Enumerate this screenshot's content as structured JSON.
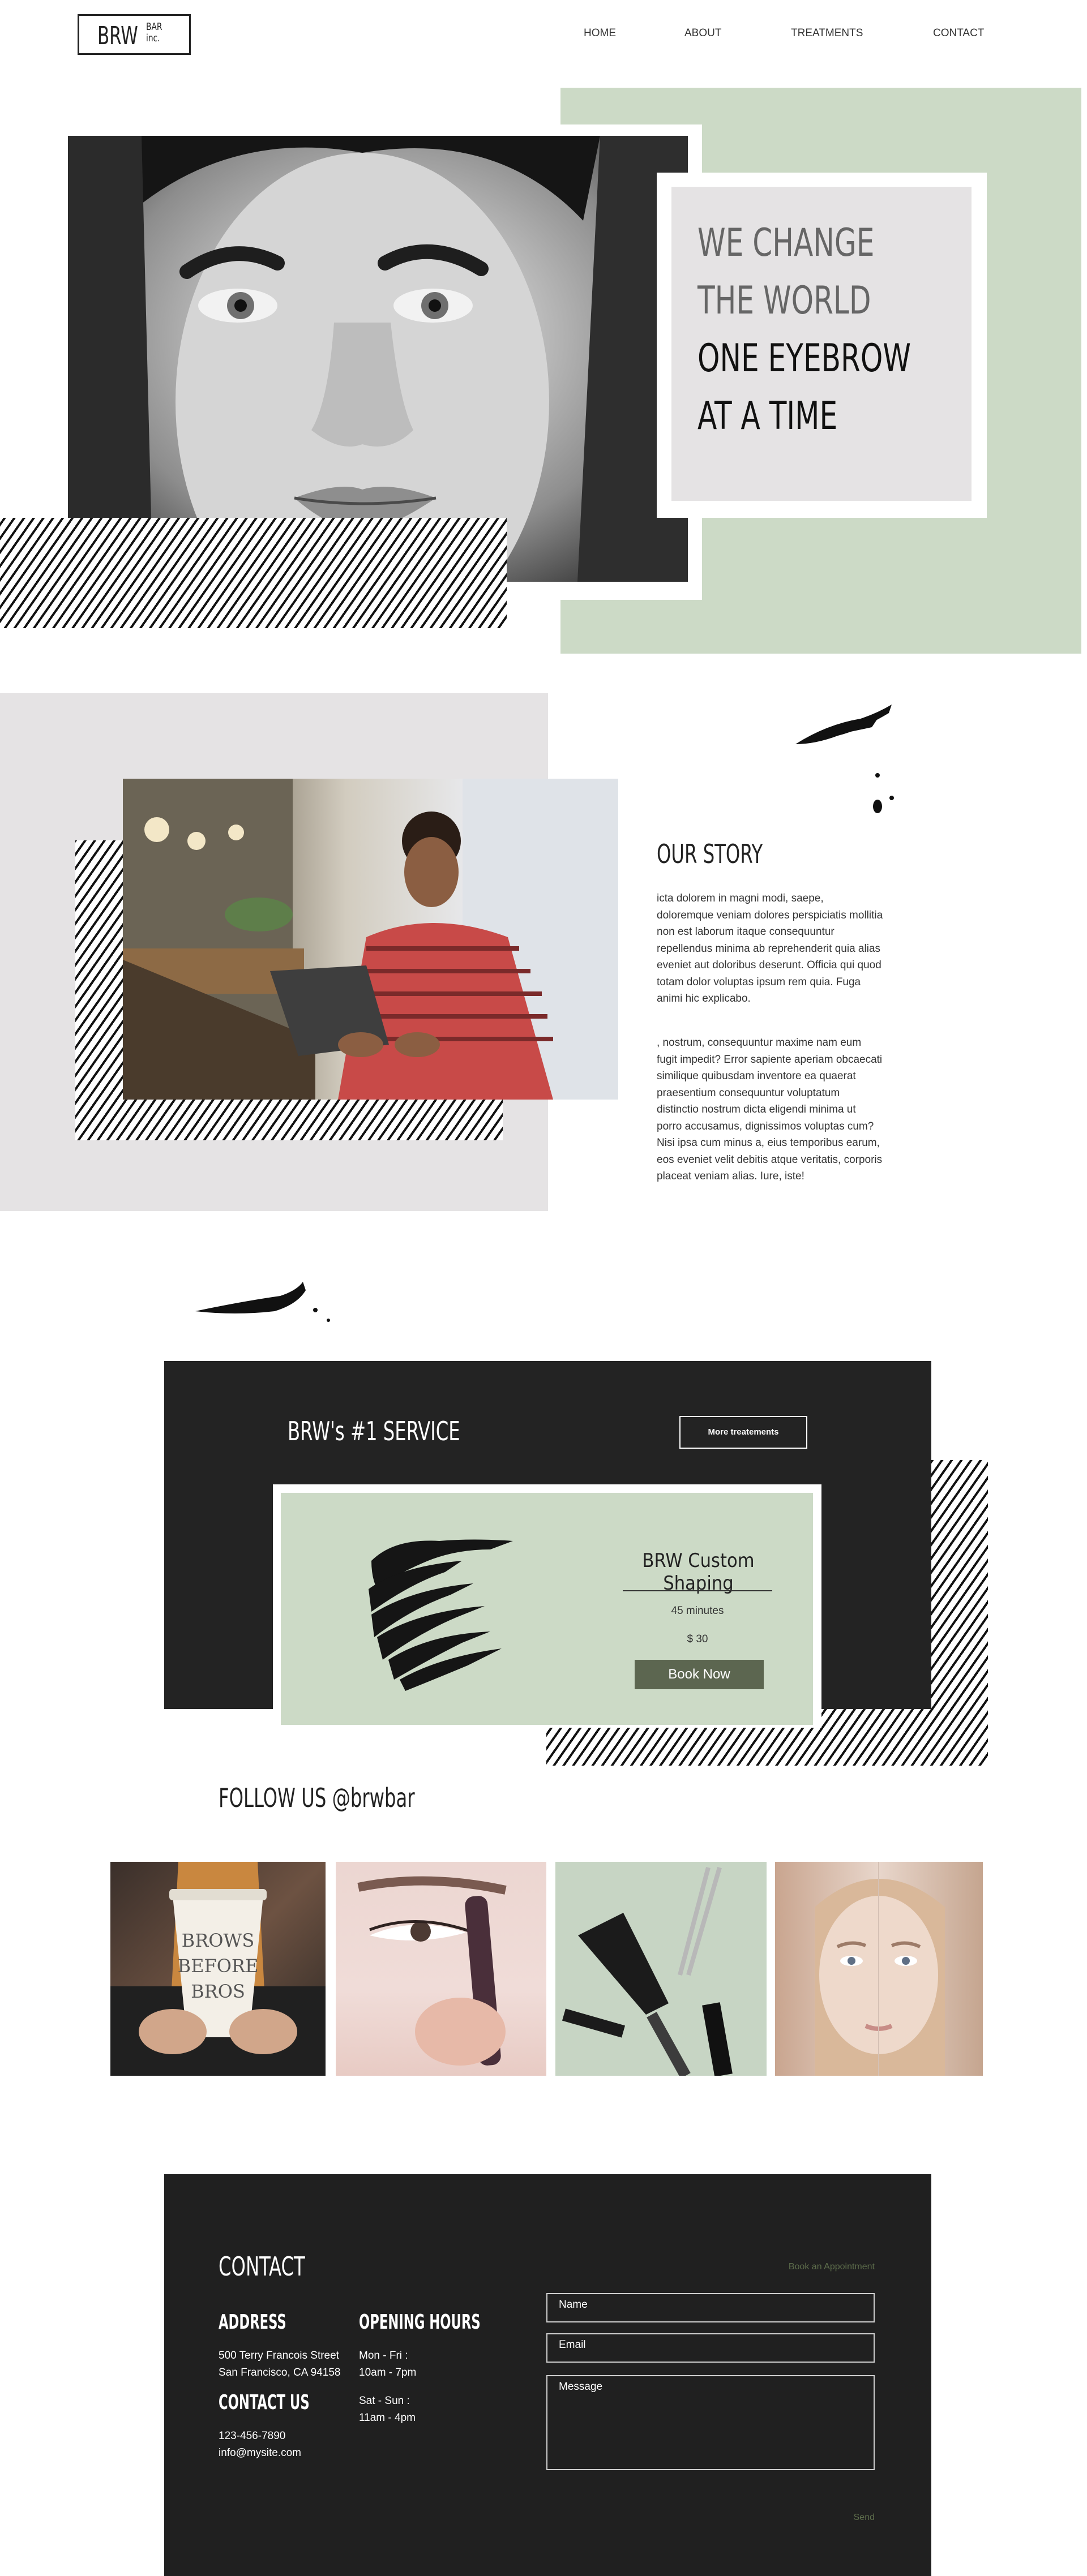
{
  "header": {
    "logo_main": "BRW",
    "logo_sub_1": "BAR",
    "logo_sub_2": "inc.",
    "nav": [
      "HOME",
      "ABOUT",
      "TREATMENTS",
      "CONTACT"
    ]
  },
  "hero": {
    "line1": "WE CHANGE",
    "line2": "THE WORLD",
    "line3": "ONE EYEBROW",
    "line4": "AT A TIME"
  },
  "story": {
    "title": "OUR STORY",
    "paragraph1": "icta dolorem in magni modi, saepe, doloremque veniam dolores perspiciatis mollitia non est laborum itaque consequuntur repellendus minima ab reprehenderit quia alias eveniet aut doloribus deserunt. Officia qui quod totam dolor voluptas ipsum rem quia. Fuga animi hic explicabo.",
    "paragraph2": ", nostrum, consequuntur maxime nam eum fugit impedit? Error sapiente aperiam obcaecati similique quibusdam inventore ea quaerat praesentium consequuntur voluptatum distinctio nostrum dicta eligendi minima ut porro accusamus, dignissimos voluptas cum? Nisi ipsa cum minus a, eius temporibus earum, eos eveniet velit debitis atque veritatis, corporis placeat veniam alias. Iure, iste!"
  },
  "service": {
    "title": "BRW's #1 SERVICE",
    "more_button": "More treatements",
    "name": "BRW Custom Shaping",
    "duration": "45 minutes",
    "price": "$ 30",
    "book_button": "Book Now"
  },
  "follow": {
    "title": "FOLLOW US @brwbar",
    "cup_text_1": "BROWS",
    "cup_text_2": "BEFORE",
    "cup_text_3": "BROS"
  },
  "contact": {
    "title": "CONTACT",
    "book_link": "Book an Appointment",
    "address_heading": "ADDRESS",
    "address_line1": "500 Terry Francois Street",
    "address_line2": "San Francisco, CA 94158",
    "hours_heading": "OPENING HOURS",
    "hours_1_days": "Mon - Fri :",
    "hours_1_time": "10am - 7pm",
    "hours_2_days": "Sat - Sun :",
    "hours_2_time": "11am - 4pm",
    "contact_heading": "CONTACT US",
    "phone": "123-456-7890",
    "email": "info@mysite.com",
    "name_placeholder": "Name",
    "email_placeholder": "Email",
    "message_placeholder": "Message",
    "send_label": "Send"
  },
  "colors": {
    "sage": "#ccdac6",
    "light_grey": "#e5e3e4",
    "dark": "#232323",
    "button_olive": "#5c6650",
    "link_olive": "#5e6e4c"
  }
}
